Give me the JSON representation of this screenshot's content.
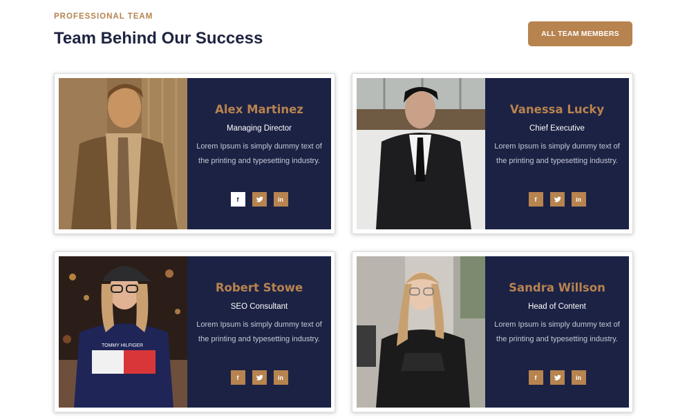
{
  "header": {
    "eyebrow": "PROFESSIONAL TEAM",
    "title": "Team Behind Our Success",
    "button_label": "ALL TEAM MEMBERS"
  },
  "colors": {
    "accent": "#b7834f",
    "panel": "#1c2244",
    "heading": "#1e2340"
  },
  "members": [
    {
      "name": "Alex Martinez",
      "role": "Managing Director",
      "desc": "Lorem Ipsum is simply dummy text of the printing and typesetting industry.",
      "socials": [
        "f",
        "twitter-icon",
        "in"
      ]
    },
    {
      "name": "Vanessa Lucky",
      "role": "Chief Executive",
      "desc": "Lorem Ipsum is simply dummy text of the printing and typesetting industry.",
      "socials": [
        "f",
        "twitter-icon",
        "in"
      ]
    },
    {
      "name": "Robert Stowe",
      "role": "SEO Consultant",
      "desc": "Lorem Ipsum is simply dummy text of the printing and typesetting industry.",
      "socials": [
        "f",
        "twitter-icon",
        "in"
      ]
    },
    {
      "name": "Sandra Willson",
      "role": "Head of Content",
      "desc": "Lorem Ipsum is simply dummy text of the printing and typesetting industry.",
      "socials": [
        "f",
        "twitter-icon",
        "in"
      ]
    }
  ],
  "photo_labels": {
    "shirt_text": "TOMMY HILFIGER"
  }
}
